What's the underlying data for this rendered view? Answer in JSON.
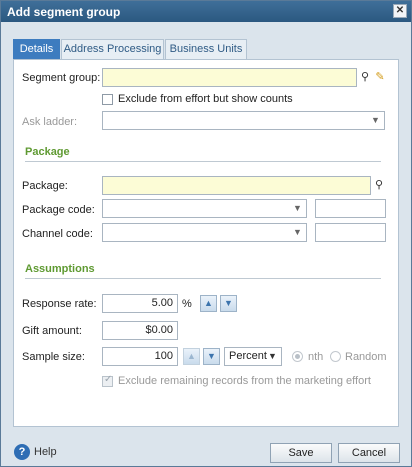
{
  "dialog": {
    "title": "Add segment group",
    "close_glyph": "✕"
  },
  "tabs": [
    {
      "label": "Details",
      "active": true
    },
    {
      "label": "Address Processing",
      "active": false
    },
    {
      "label": "Business Units",
      "active": false
    }
  ],
  "details": {
    "segment_group": {
      "label": "Segment group:",
      "value": ""
    },
    "exclude_effort": {
      "label": "Exclude from effort but show counts",
      "checked": false
    },
    "ask_ladder": {
      "label": "Ask ladder:",
      "value": ""
    },
    "package_section": "Package",
    "package": {
      "label": "Package:",
      "value": ""
    },
    "package_code": {
      "label": "Package code:",
      "value": "",
      "text": ""
    },
    "channel_code": {
      "label": "Channel code:",
      "value": "",
      "text": ""
    },
    "assumptions_section": "Assumptions",
    "response_rate": {
      "label": "Response rate:",
      "value": "5.00",
      "unit": "%"
    },
    "gift_amount": {
      "label": "Gift amount:",
      "value": "$0.00"
    },
    "sample_size": {
      "label": "Sample size:",
      "value": "100",
      "type": "Percent",
      "nth_label": "nth",
      "random_label": "Random",
      "selected": "nth"
    },
    "exclude_remaining": {
      "label": "Exclude remaining records from the marketing effort",
      "checked": true
    }
  },
  "footer": {
    "help_label": "Help",
    "save_label": "Save",
    "cancel_label": "Cancel"
  },
  "icons": {
    "search": "⚲",
    "edit": "✎",
    "dropdown": "▼",
    "up": "▲",
    "down": "▼",
    "help": "?"
  },
  "colors": {
    "title_bar": "#2b5880",
    "active_tab": "#3d7cbf",
    "section_title": "#5f9a32",
    "required_field": "#fcfcd6"
  }
}
